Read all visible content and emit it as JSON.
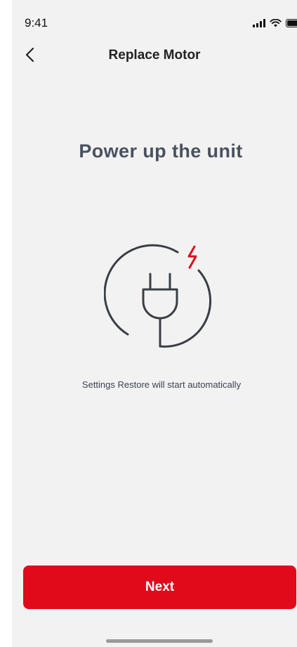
{
  "status_bar": {
    "time": "9:41",
    "icons": [
      "signal-icon",
      "wifi-icon",
      "battery-icon"
    ]
  },
  "nav": {
    "back_icon": "chevron-left-icon",
    "title": "Replace Motor"
  },
  "main": {
    "headline": "Power up the unit",
    "illustration": "power-plug-icon",
    "subtitle": "Settings Restore will start automatically"
  },
  "footer": {
    "next_label": "Next"
  },
  "colors": {
    "accent": "#e10a1b",
    "background": "#f2f2f2",
    "headline": "#4a5160"
  }
}
